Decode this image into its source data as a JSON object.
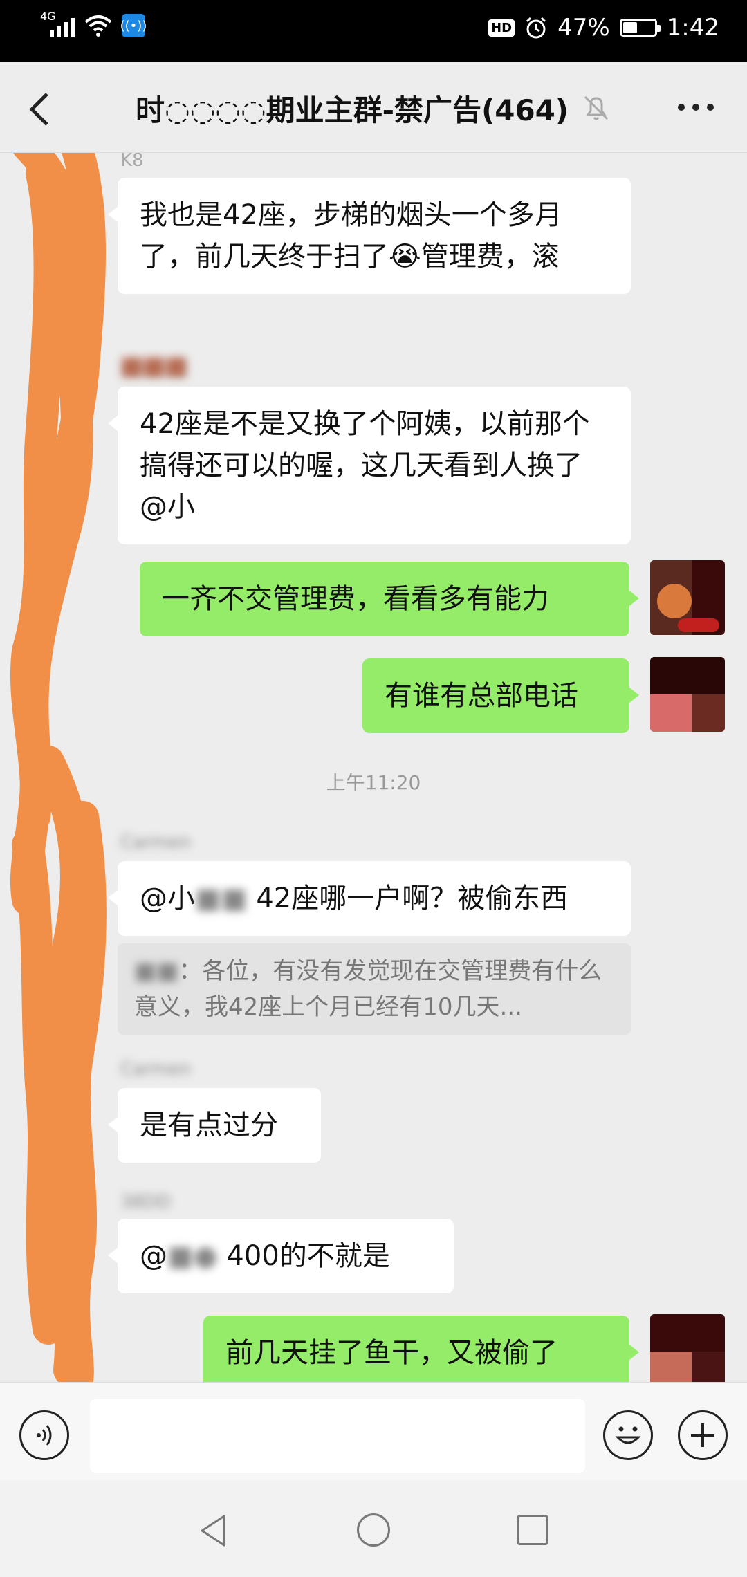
{
  "status_bar": {
    "network": "4G",
    "hd_badge": "HD",
    "battery_text": "47%",
    "battery_level": 0.47,
    "time": "1:42"
  },
  "header": {
    "title": "时◌◌◌◌期业主群-禁广告(464)"
  },
  "messages": [
    {
      "sender": "K8",
      "text": "我也是42座，步梯的烟头一个多月了，前几天终于扫了😭管理费，滚"
    },
    {
      "text": "42座是不是又换了个阿姨，以前那个搞得还可以的喔，这几天看到人换了@小"
    },
    {
      "text": "一齐不交管理费，看看多有能力"
    },
    {
      "text": "有谁有总部电话"
    },
    {
      "timestamp": "上午11:20"
    },
    {
      "sender": "Carmen",
      "text_prefix": "@小",
      "text": "42座哪一户啊？被偷东西"
    },
    {
      "quote": "：各位，有没有发觉现在交管理费有什么意义，我42座上个月已经有10几天..."
    },
    {
      "sender": "Carmen",
      "text": "是有点过分"
    },
    {
      "sender": "38DD",
      "text_prefix": "@",
      "text": "400的不就是"
    },
    {
      "text": "前几天挂了鱼干，又被偷了"
    }
  ],
  "colors": {
    "out_bubble": "#95ec69",
    "in_bubble": "#ffffff",
    "chat_bg": "#ededed",
    "scribble": "#f28c44"
  }
}
